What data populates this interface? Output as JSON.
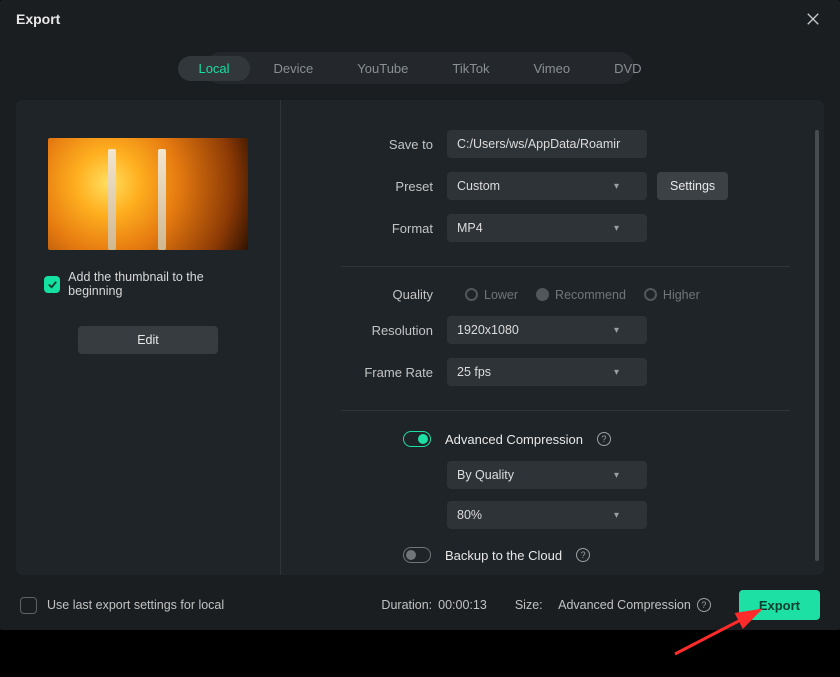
{
  "window": {
    "title": "Export"
  },
  "tabs": [
    "Local",
    "Device",
    "YouTube",
    "TikTok",
    "Vimeo",
    "DVD"
  ],
  "active_tab_index": 0,
  "thumbnail": {
    "checkbox_label": "Add the thumbnail to the beginning",
    "edit_label": "Edit"
  },
  "form": {
    "save_to_label": "Save to",
    "save_to_value": "C:/Users/ws/AppData/Roamir",
    "preset_label": "Preset",
    "preset_value": "Custom",
    "settings_label": "Settings",
    "format_label": "Format",
    "format_value": "MP4",
    "quality_label": "Quality",
    "quality_options": [
      "Lower",
      "Recommend",
      "Higher"
    ],
    "resolution_label": "Resolution",
    "resolution_value": "1920x1080",
    "framerate_label": "Frame Rate",
    "framerate_value": "25 fps",
    "advcomp_label": "Advanced Compression",
    "advcomp_mode": "By Quality",
    "advcomp_value": "80%",
    "backup_label": "Backup to the Cloud"
  },
  "footer": {
    "uselast_label": "Use last export settings for local",
    "duration_label": "Duration:",
    "duration_value": "00:00:13",
    "size_label": "Size:",
    "size_value": "Advanced Compression",
    "export_label": "Export"
  }
}
